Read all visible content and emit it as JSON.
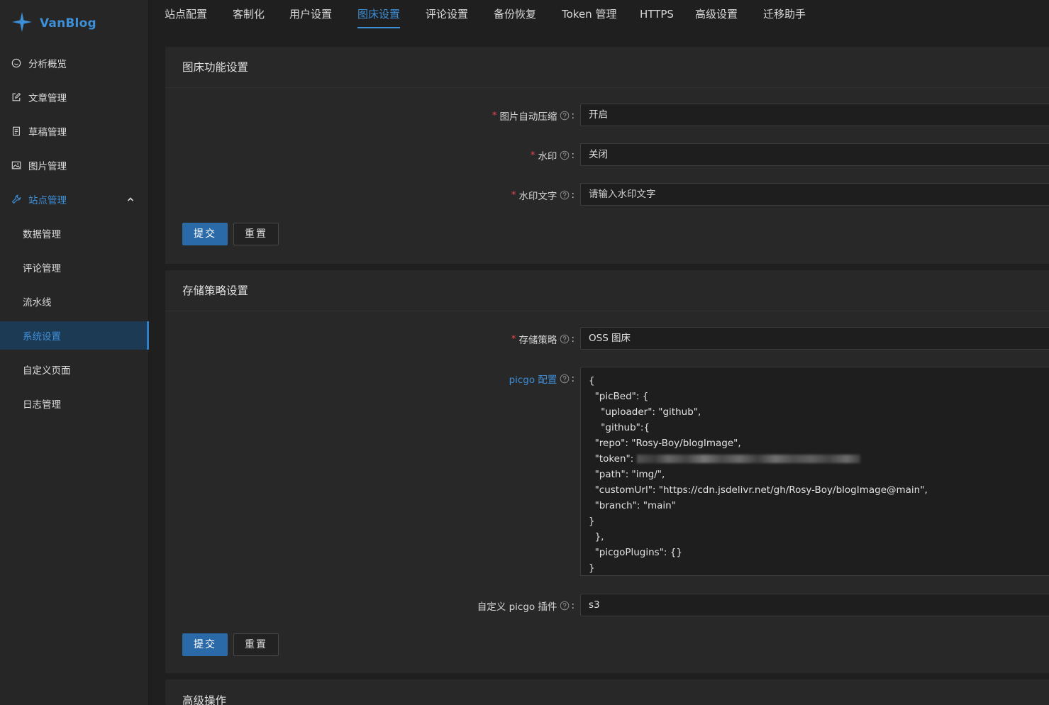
{
  "brand": {
    "name": "VanBlog"
  },
  "sidebar": {
    "items": [
      {
        "label": "分析概览",
        "icon": "dashboard-icon"
      },
      {
        "label": "文章管理",
        "icon": "edit-icon"
      },
      {
        "label": "草稿管理",
        "icon": "draft-icon"
      },
      {
        "label": "图片管理",
        "icon": "image-icon"
      },
      {
        "label": "站点管理",
        "icon": "tool-icon",
        "expanded": true
      },
      {
        "label": "数据管理"
      },
      {
        "label": "评论管理"
      },
      {
        "label": "流水线"
      },
      {
        "label": "系统设置",
        "selected": true
      },
      {
        "label": "自定义页面"
      },
      {
        "label": "日志管理"
      }
    ]
  },
  "tabs": [
    {
      "label": "站点配置"
    },
    {
      "label": "客制化"
    },
    {
      "label": "用户设置"
    },
    {
      "label": "图床设置",
      "active": true
    },
    {
      "label": "评论设置"
    },
    {
      "label": "备份恢复"
    },
    {
      "label": "Token 管理"
    },
    {
      "label": "HTTPS"
    },
    {
      "label": "高级设置"
    },
    {
      "label": "迁移助手"
    }
  ],
  "image_bed": {
    "title": "图床功能设置",
    "compress_label": "图片自动压缩",
    "compress_value": "开启",
    "watermark_label": "水印",
    "watermark_value": "关闭",
    "watermark_text_label": "水印文字",
    "watermark_text_placeholder": "请输入水印文字",
    "submit": "提交",
    "reset": "重置"
  },
  "storage": {
    "title": "存储策略设置",
    "strategy_label": "存储策略",
    "strategy_value": "OSS 图床",
    "picgo_label": "picgo 配置",
    "picgo_lines": [
      "{",
      "  \"picBed\": {",
      "    \"uploader\": \"github\",",
      "    \"github\":{",
      "  \"repo\": \"Rosy-Boy/blogImage\",",
      "  \"token\": ",
      "  \"path\": \"img/\",",
      "  \"customUrl\": \"https://cdn.jsdelivr.net/gh/Rosy-Boy/blogImage@main\",",
      "  \"branch\": \"main\"",
      "}",
      "  },",
      "  \"picgoPlugins\": {}",
      "}"
    ],
    "plugin_label": "自定义 picgo 插件",
    "plugin_value": "s3",
    "submit": "提交",
    "reset": "重置"
  },
  "advanced": {
    "title": "高级操作"
  },
  "colors": {
    "accent": "#3d8fd8",
    "required": "#e5484d",
    "primary_button": "#2b6aa8"
  }
}
